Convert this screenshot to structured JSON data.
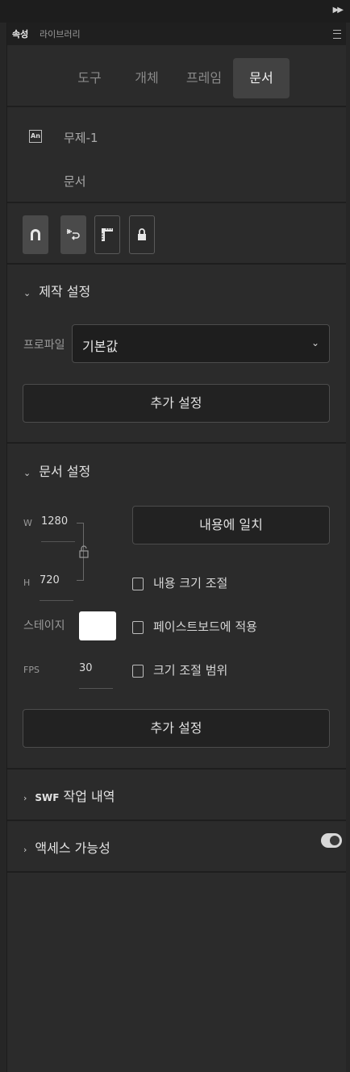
{
  "panel": {
    "collapse_icon": "double-chevron-right-icon",
    "tabs": [
      {
        "label": "속성",
        "active": true
      },
      {
        "label": "라이브러리",
        "active": false
      }
    ],
    "menu_icon": "panel-menu-icon"
  },
  "segments": [
    "도구",
    "개체",
    "프레임",
    "문서"
  ],
  "active_segment": "문서",
  "doc": {
    "logo_text": "An",
    "name": "무제-1",
    "type_label": "문서"
  },
  "tool_icons": [
    "magnet-snap-icon",
    "undo-history-icon",
    "ruler-icon",
    "lock-icon"
  ],
  "publish": {
    "title": "제작 설정",
    "profile_label": "프로파일",
    "profile_value": "기본값",
    "more_button": "추가 설정"
  },
  "document_settings": {
    "title": "문서 설정",
    "w_label": "W",
    "w_value": "1280",
    "h_label": "H",
    "h_value": "720",
    "fit_button": "내용에 일치",
    "stage_label": "스테이지",
    "stage_color": "#ffffff",
    "fps_label": "FPS",
    "fps_value": "30",
    "checkboxes": [
      "내용 크기 조절",
      "페이스트보드에 적용",
      "크기 조절 범위"
    ],
    "more_button": "추가 설정"
  },
  "swf_section": {
    "title_prefix": "SWF",
    "title": "작업 내역"
  },
  "accessibility": {
    "title": "액세스 가능성",
    "toggle_on": true
  }
}
